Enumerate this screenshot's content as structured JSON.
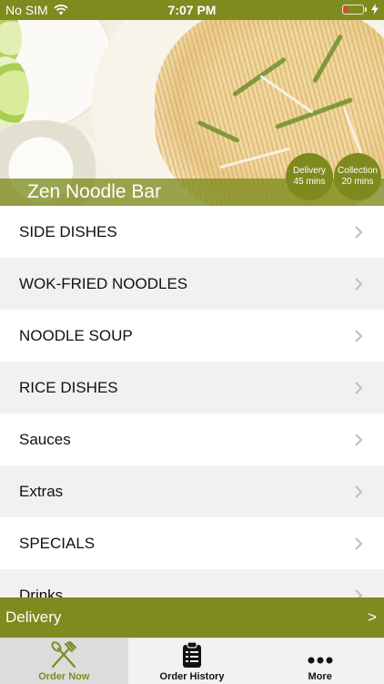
{
  "status_bar": {
    "carrier": "No SIM",
    "time": "7:07 PM"
  },
  "restaurant": {
    "name": "Zen Noodle Bar"
  },
  "badges": {
    "delivery": {
      "label": "Delivery",
      "time": "45 mins"
    },
    "collection": {
      "label": "Collection",
      "time": "20 mins"
    }
  },
  "menu": {
    "items": [
      {
        "label": "SIDE DISHES"
      },
      {
        "label": "WOK-FRIED NOODLES"
      },
      {
        "label": "NOODLE SOUP"
      },
      {
        "label": "RICE DISHES"
      },
      {
        "label": "Sauces"
      },
      {
        "label": "Extras"
      },
      {
        "label": "SPECIALS"
      },
      {
        "label": "Drinks"
      }
    ]
  },
  "delivery_bar": {
    "label": "Delivery",
    "arrow": ">"
  },
  "tabs": [
    {
      "label": "Order Now",
      "icon": "fork-knife-icon",
      "active": true
    },
    {
      "label": "Order History",
      "icon": "clipboard-icon",
      "active": false
    },
    {
      "label": "More",
      "icon": "more-dots-icon",
      "active": false
    }
  ],
  "colors": {
    "accent": "#7f8a1f",
    "battery_low": "#e2402a"
  }
}
